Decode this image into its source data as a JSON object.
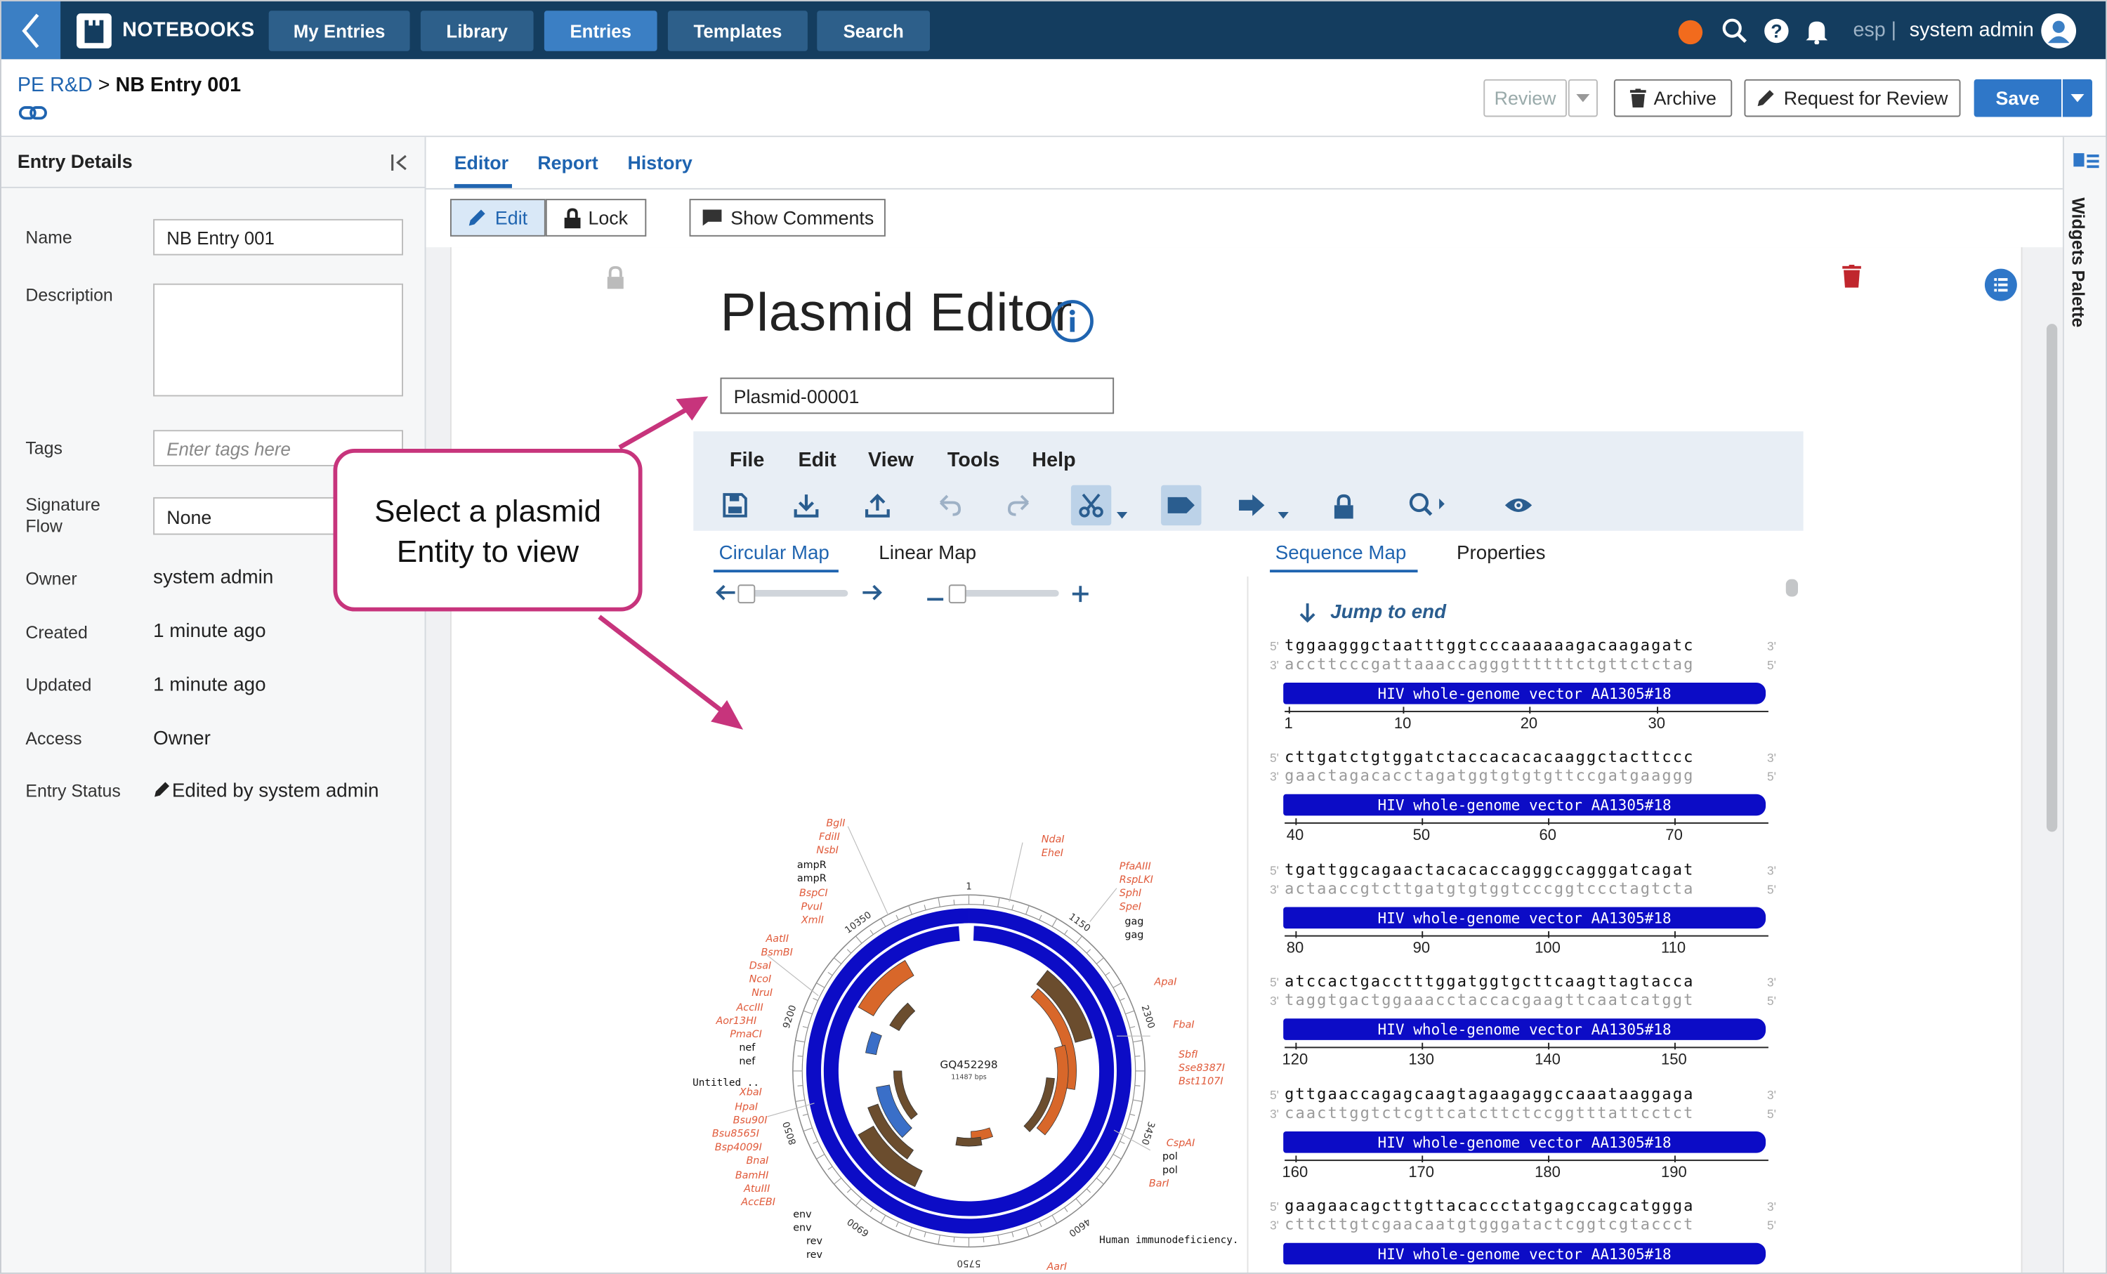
{
  "topbar": {
    "brand": "NOTEBOOKS",
    "nav": [
      "My Entries",
      "Library",
      "Entries",
      "Templates",
      "Search"
    ],
    "active_nav": "Entries",
    "lang": "esp |",
    "user": "system admin"
  },
  "header": {
    "breadcrumb_link": "PE R&D",
    "breadcrumb_sep": ">",
    "breadcrumb_current": "NB Entry 001",
    "review_label": "Review",
    "archive_label": "Archive",
    "request_review_label": "Request for Review",
    "save_label": "Save"
  },
  "entry_details": {
    "title": "Entry Details",
    "fields": {
      "name_label": "Name",
      "name_value": "NB Entry 001",
      "description_label": "Description",
      "tags_label": "Tags",
      "tags_placeholder": "Enter tags here",
      "signature_label": "Signature\nFlow",
      "signature_value": "None",
      "owner_label": "Owner",
      "owner_value": "system admin",
      "created_label": "Created",
      "created_value": "1 minute ago",
      "updated_label": "Updated",
      "updated_value": "1 minute ago",
      "access_label": "Access",
      "access_value": "Owner",
      "status_label": "Entry Status",
      "status_value": "Edited by system admin"
    }
  },
  "main": {
    "tabs": [
      "Editor",
      "Report",
      "History"
    ],
    "active_tab": "Editor",
    "edit_label": "Edit",
    "lock_label": "Lock",
    "comments_label": "Show Comments",
    "widgets_palette": "Widgets Palette"
  },
  "plasmid_editor": {
    "title": "Plasmid Editor",
    "entity_value": "Plasmid-00001",
    "menus": [
      "File",
      "Edit",
      "View",
      "Tools",
      "Help"
    ],
    "view_tabs": [
      "Circular Map",
      "Linear Map"
    ],
    "right_tabs": [
      "Sequence Map",
      "Properties"
    ],
    "jump_label": "Jump to end",
    "feature_label": "HIV whole-genome vector AA1305#18",
    "map_name": "GQ452298",
    "map_size": "11487 bps",
    "map_side_label": "Human immunodeficiency..",
    "map_untitled": "Untitled ..",
    "rows": [
      {
        "top": "tggaagggctaatttggtcccaaaaaagacaagagatc",
        "bottom": "accttcccgattaaaccagggttttttctgttctctag",
        "ticks": [
          "1",
          "10",
          "20",
          "30"
        ]
      },
      {
        "top": "cttgatctgtggatctaccacacacaaggctacttccc",
        "bottom": "gaactagacacctagatggtgtgtgttccgatgaaggg",
        "ticks": [
          "40",
          "50",
          "60",
          "70"
        ]
      },
      {
        "top": "tgattggcagaactacacaccagggccagggatcagat",
        "bottom": "actaaccgtcttgatgtgtggtcccggtccctagtcta",
        "ticks": [
          "80",
          "90",
          "100",
          "110"
        ]
      },
      {
        "top": "atccactgacctttggatggtgcttcaagttagtacca",
        "bottom": "taggtgactggaaacctaccacgaagttcaatcatggt",
        "ticks": [
          "120",
          "130",
          "140",
          "150"
        ]
      },
      {
        "top": "gttgaaccagagcaagtagaagaggccaaataaggaga",
        "bottom": "caacttggtctcgttcatcttctccggtttattcctct",
        "ticks": [
          "160",
          "170",
          "180",
          "190"
        ]
      },
      {
        "top": "gaagaacagcttgttacaccctatgagccagcatggga",
        "bottom": "cttcttgtcgaacaatgtgggatactcggtcgtaccct",
        "ticks": []
      }
    ],
    "enzymes_left": [
      "BglI",
      "FdiII",
      "NsbI",
      "ampR",
      "ampR",
      "BspCI",
      "PvuI",
      "XmlI",
      "AatII",
      "BsmBI",
      "DsaI",
      "NcoI",
      "NruI",
      "AccIII",
      "Aor13HI",
      "PmaCI",
      "nef",
      "nef",
      "XbaI",
      "HpaI",
      "Bsu90I",
      "Bsu8565I",
      "Bsp4009I",
      "BnaI",
      "BamHI",
      "AtuIII",
      "AccEBI",
      "env",
      "env",
      "rev",
      "rev"
    ],
    "enzymes_top": [
      "NdaI",
      "EheI"
    ],
    "enzymes_right": [
      "PfaAIII",
      "RspLKI",
      "SphI",
      "SpeI",
      "gag",
      "gag",
      "ApaI",
      "FbaI",
      "SbfI",
      "Sse8387I",
      "Bst1107I",
      "CspAI",
      "pol",
      "pol",
      "BarI",
      "AarI"
    ],
    "tick_labels": [
      "1",
      "1150",
      "2300",
      "3450",
      "4600",
      "5750",
      "6900",
      "8050",
      "9200",
      "10350"
    ]
  },
  "callout": {
    "text": "Select a plasmid Entity to view"
  },
  "colors": {
    "nav_bg": "#143d5f",
    "accent": "#3b7fc4",
    "feature": "#0c0cc6",
    "callout": "#c7347c",
    "enzyme": "#e05a3a",
    "orange": "#d8672a",
    "brown": "#6b4d2e"
  }
}
